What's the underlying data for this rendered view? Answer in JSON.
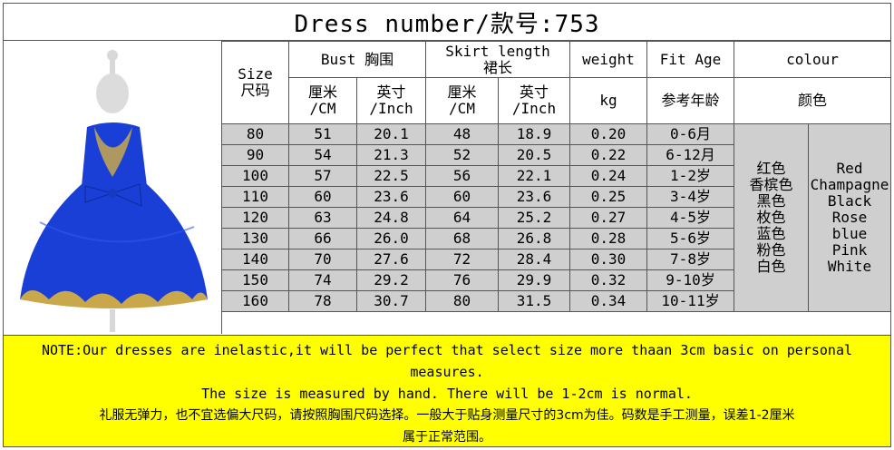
{
  "title": "Dress number/款号:753",
  "header": {
    "size": "Size",
    "size_cn": "尺码",
    "bust": "Bust 胸围",
    "skirt_length": "Skirt length",
    "skirt_length_cn": "裙长",
    "weight": "weight",
    "fit_age": "Fit Age",
    "colour": "colour",
    "cm_cn": "厘米",
    "cm": "/CM",
    "inch_cn": "英寸",
    "inch": "/Inch",
    "kg": "kg",
    "fit_age_cn": "参考年龄",
    "colour_cn": "颜色"
  },
  "rows": [
    {
      "size": "80",
      "bust_cm": "51",
      "bust_in": "20.1",
      "len_cm": "48",
      "len_in": "18.9",
      "weight": "0.20",
      "age": "0-6月"
    },
    {
      "size": "90",
      "bust_cm": "54",
      "bust_in": "21.3",
      "len_cm": "52",
      "len_in": "20.5",
      "weight": "0.22",
      "age": "6-12月"
    },
    {
      "size": "100",
      "bust_cm": "57",
      "bust_in": "22.5",
      "len_cm": "56",
      "len_in": "22.1",
      "weight": "0.24",
      "age": "1-2岁"
    },
    {
      "size": "110",
      "bust_cm": "60",
      "bust_in": "23.6",
      "len_cm": "60",
      "len_in": "23.6",
      "weight": "0.25",
      "age": "3-4岁"
    },
    {
      "size": "120",
      "bust_cm": "63",
      "bust_in": "24.8",
      "len_cm": "64",
      "len_in": "25.2",
      "weight": "0.27",
      "age": "4-5岁"
    },
    {
      "size": "130",
      "bust_cm": "66",
      "bust_in": "26.0",
      "len_cm": "68",
      "len_in": "26.8",
      "weight": "0.28",
      "age": "5-6岁"
    },
    {
      "size": "140",
      "bust_cm": "70",
      "bust_in": "27.6",
      "len_cm": "72",
      "len_in": "28.4",
      "weight": "0.30",
      "age": "7-8岁"
    },
    {
      "size": "150",
      "bust_cm": "74",
      "bust_in": "29.2",
      "len_cm": "76",
      "len_in": "29.9",
      "weight": "0.32",
      "age": "9-10岁"
    },
    {
      "size": "160",
      "bust_cm": "78",
      "bust_in": "30.7",
      "len_cm": "80",
      "len_in": "31.5",
      "weight": "0.34",
      "age": "10-11岁"
    }
  ],
  "colours_cn": [
    "红色",
    "香槟色",
    "黑色",
    "枚色",
    "蓝色",
    "粉色",
    "白色"
  ],
  "colours_en": [
    "Red",
    "Champagne",
    "Black",
    "Rose",
    "blue",
    "Pink",
    "White"
  ],
  "note": {
    "line1": "NOTE:Our dresses are inelastic,it will be perfect that select size more thaan 3cm basic on personal",
    "line2": "measures.",
    "line3": "The size is measured by hand. There will be 1-2cm is normal.",
    "line4": "礼服无弹力，也不宜选偏大尺码，请按照胸围尺码选择。一般大于贴身测量尺寸的3cm为佳。码数是手工测量，误差1-2厘米",
    "line5": "属于正常范围。"
  },
  "colors": {
    "dress_blue": "#1a3fd6",
    "gold_trim": "#c9a84c",
    "note_bg": "#ffff00",
    "cell_grey": "#cfcfcf"
  }
}
